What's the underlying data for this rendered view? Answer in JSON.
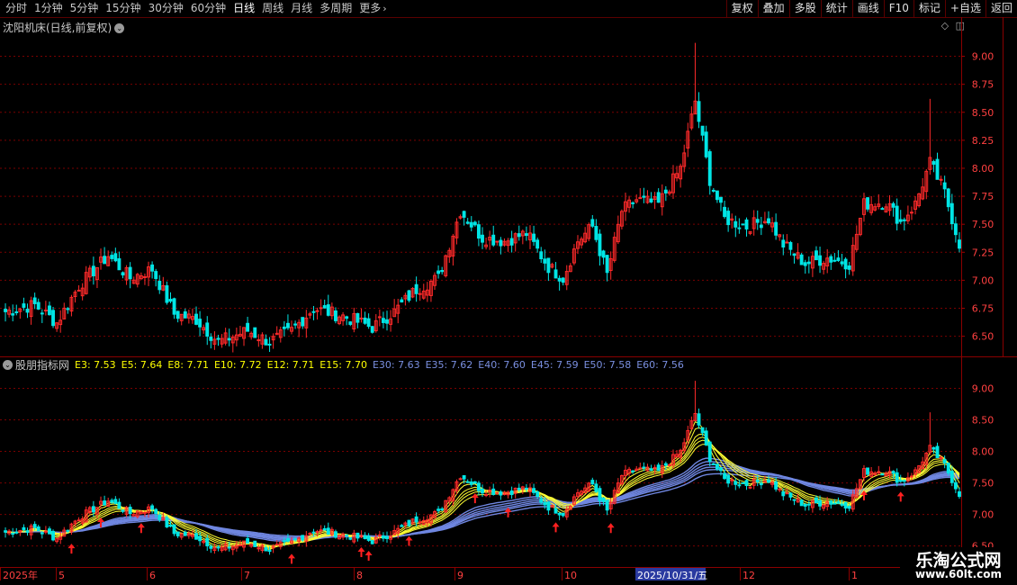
{
  "toolbar": {
    "periods": [
      "分时",
      "1分钟",
      "5分钟",
      "15分钟",
      "30分钟",
      "60分钟",
      "日线",
      "周线",
      "月线",
      "多周期",
      "更多"
    ],
    "active_period": "日线",
    "more_icon": "chevron-right-icon",
    "right_buttons": [
      "复权",
      "叠加",
      "多股",
      "统计",
      "画线",
      "F10",
      "标记",
      "+自选",
      "返回"
    ]
  },
  "main_panel": {
    "title": "沈阳机床(日线,前复权)",
    "title_icon": "chevron-down-icon",
    "y_labels": [
      "9.00",
      "8.75",
      "8.50",
      "8.25",
      "8.00",
      "7.75",
      "7.50",
      "7.25",
      "7.00",
      "6.75",
      "6.50"
    ],
    "y_range": [
      6.32,
      9.35
    ]
  },
  "indicator_panel": {
    "title": "股朋指标网",
    "title_icon": "chevron-down-icon",
    "legend": [
      {
        "label": "E3: 7.53",
        "color": "#ffff00"
      },
      {
        "label": "E5: 7.64",
        "color": "#ffff00"
      },
      {
        "label": "E8: 7.71",
        "color": "#ffff00"
      },
      {
        "label": "E10: 7.72",
        "color": "#ffff00"
      },
      {
        "label": "E12: 7.71",
        "color": "#ffff00"
      },
      {
        "label": "E15: 7.70",
        "color": "#ffff00"
      },
      {
        "label": "E30: 7.63",
        "color": "#7a8fe0"
      },
      {
        "label": "E35: 7.62",
        "color": "#7a8fe0"
      },
      {
        "label": "E40: 7.60",
        "color": "#7a8fe0"
      },
      {
        "label": "E45: 7.59",
        "color": "#7a8fe0"
      },
      {
        "label": "E50: 7.58",
        "color": "#7a8fe0"
      },
      {
        "label": "E60: 7.56",
        "color": "#7a8fe0"
      }
    ],
    "y_labels": [
      "9.00",
      "8.50",
      "8.00",
      "7.50",
      "7.00",
      "6.50"
    ],
    "y_range": [
      6.48,
      9.25
    ]
  },
  "date_axis": {
    "labels": [
      "2025年",
      "5",
      "6",
      "7",
      "8",
      "9",
      "10",
      "2025/10/31/五",
      "12",
      "1"
    ],
    "highlight": "2025/10/31/五"
  },
  "colors": {
    "up": "#ff2a2a",
    "down": "#00e5e5",
    "grid": "#7a0000",
    "axis_text": "#ff4040"
  },
  "watermark": {
    "line1": "乐淘公式网",
    "line2": "www.60lt.com"
  },
  "chart_data": {
    "type": "candlestick",
    "series_count": 240,
    "peak_high": 9.12,
    "peak_date": "2025/10/31",
    "low": 6.4,
    "last_close": 7.33
  }
}
